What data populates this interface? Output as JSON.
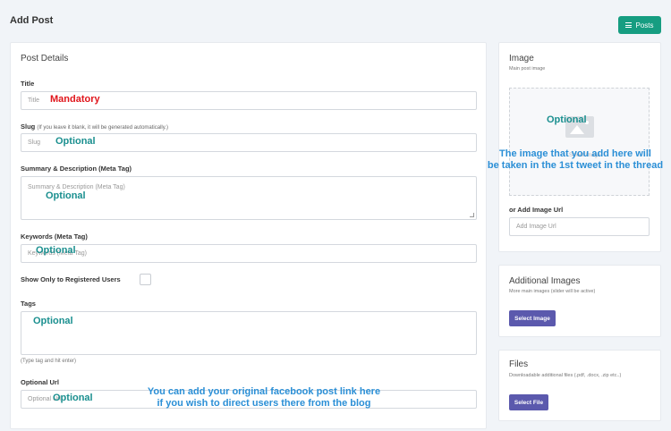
{
  "header": {
    "title": "Add Post",
    "posts_button": "Posts",
    "posts_icon": "menu-icon"
  },
  "post_details": {
    "title": "Post Details",
    "fields": {
      "title": {
        "label": "Title",
        "placeholder": "Title"
      },
      "slug": {
        "label": "Slug",
        "note": "(If you leave it blank, it will be generated automatically.)",
        "placeholder": "Slug"
      },
      "summary": {
        "label": "Summary & Description (Meta Tag)",
        "placeholder": "Summary & Description (Meta Tag)"
      },
      "keywords": {
        "label": "Keywords (Meta Tag)",
        "placeholder": "Keywords (Meta Tag)"
      },
      "registered": {
        "label": "Show Only to Registered Users"
      },
      "tags": {
        "label": "Tags",
        "hint": "(Type tag and hit enter)"
      },
      "optional_url": {
        "label": "Optional Url",
        "placeholder": "Optional Url"
      }
    }
  },
  "annotations": {
    "title": "Mandatory",
    "slug": "Optional",
    "summary": "Optional",
    "keywords": "Optional",
    "tags": "Optional",
    "optional_url": "Optional",
    "image": "Optional",
    "image_note_line1": "The image that you add here will",
    "image_note_line2": "be taken in the 1st tweet in the thread",
    "url_note_line1": "You can add your original facebook post link here",
    "url_note_line2": "if you wish to direct users there from the blog"
  },
  "image_panel": {
    "title": "Image",
    "subtitle": "Main post image",
    "drop_text": "Select Image",
    "or_url_label": "or Add Image Url",
    "url_placeholder": "Add Image Url"
  },
  "additional_images": {
    "title": "Additional Images",
    "subtitle": "More main images (slider will be active)",
    "button": "Select Image"
  },
  "files": {
    "title": "Files",
    "subtitle": "Downloadable additional files (.pdf, .docx, .zip etc..)",
    "button": "Select File"
  },
  "colors": {
    "accent_green": "#169d81",
    "button_purple": "#5b59ad",
    "annotation_red": "#e0151b",
    "annotation_teal": "#1a8f8f",
    "annotation_blue": "#2b8fd6"
  }
}
